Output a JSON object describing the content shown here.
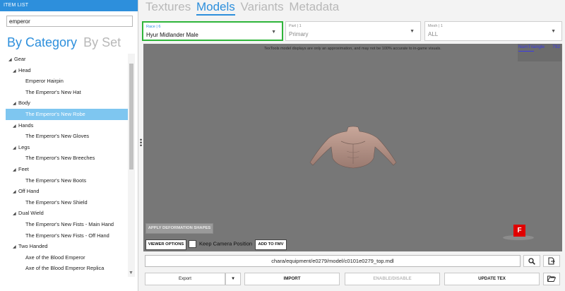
{
  "item_list": {
    "header": "ITEM LIST",
    "search_value": "emperor",
    "tabs": {
      "by_category": "By Category",
      "by_set": "By Set"
    },
    "tree": [
      {
        "label": "Gear",
        "level": 0,
        "expanded": true
      },
      {
        "label": "Head",
        "level": 1,
        "expanded": true
      },
      {
        "label": "Emperor Hairpin",
        "level": 2
      },
      {
        "label": "The Emperor's New Hat",
        "level": 2
      },
      {
        "label": "Body",
        "level": 1,
        "expanded": true
      },
      {
        "label": "The Emperor's New Robe",
        "level": 2,
        "selected": true
      },
      {
        "label": "Hands",
        "level": 1,
        "expanded": true
      },
      {
        "label": "The Emperor's New Gloves",
        "level": 2
      },
      {
        "label": "Legs",
        "level": 1,
        "expanded": true
      },
      {
        "label": "The Emperor's New Breeches",
        "level": 2
      },
      {
        "label": "Feet",
        "level": 1,
        "expanded": true
      },
      {
        "label": "The Emperor's New Boots",
        "level": 2
      },
      {
        "label": "Off Hand",
        "level": 1,
        "expanded": true
      },
      {
        "label": "The Emperor's New Shield",
        "level": 2
      },
      {
        "label": "Dual Wield",
        "level": 1,
        "expanded": true
      },
      {
        "label": "The Emperor's New Fists - Main Hand",
        "level": 2
      },
      {
        "label": "The Emperor's New Fists - Off Hand",
        "level": 2
      },
      {
        "label": "Two Handed",
        "level": 1,
        "expanded": true
      },
      {
        "label": "Axe of the Blood Emperor",
        "level": 2
      },
      {
        "label": "Axe of the Blood Emperor Replica",
        "level": 2
      }
    ]
  },
  "main_tabs": [
    "Textures",
    "Models",
    "Variants",
    "Metadata"
  ],
  "active_tab": "Models",
  "dropdowns": {
    "race": {
      "caption": "Race | 6",
      "value": "Hyur Midlander Male"
    },
    "part": {
      "caption": "Part | 1",
      "value": "Primary"
    },
    "mesh": {
      "caption": "Mesh | 1",
      "value": "ALL"
    }
  },
  "viewport": {
    "note": "TexTools model displays are only an approximation, and may not be 100% accurate to in-game visuals.",
    "num_triangle_label": "NumTriangle",
    "num_triangle_value": "792",
    "apply_deformation_label": "APPLY DEFORMATION SHAPES",
    "viewer_options_label": "VIEWER OPTIONS",
    "keep_camera_label": "Keep Camera Position",
    "add_to_fmv_label": "ADD TO FMV",
    "f_badge": "F"
  },
  "path": "chara/equipment/e0279/model/c0101e0279_top.mdl",
  "actions": {
    "export": "Export",
    "import": "IMPORT",
    "enable_disable": "ENABLE/DISABLE",
    "update_tex": "UPDATE TEX"
  },
  "colors": {
    "accent": "#2d8fdc",
    "race_border": "#2fb53a",
    "selection": "#7ec6f0",
    "badge": "#e00000"
  }
}
